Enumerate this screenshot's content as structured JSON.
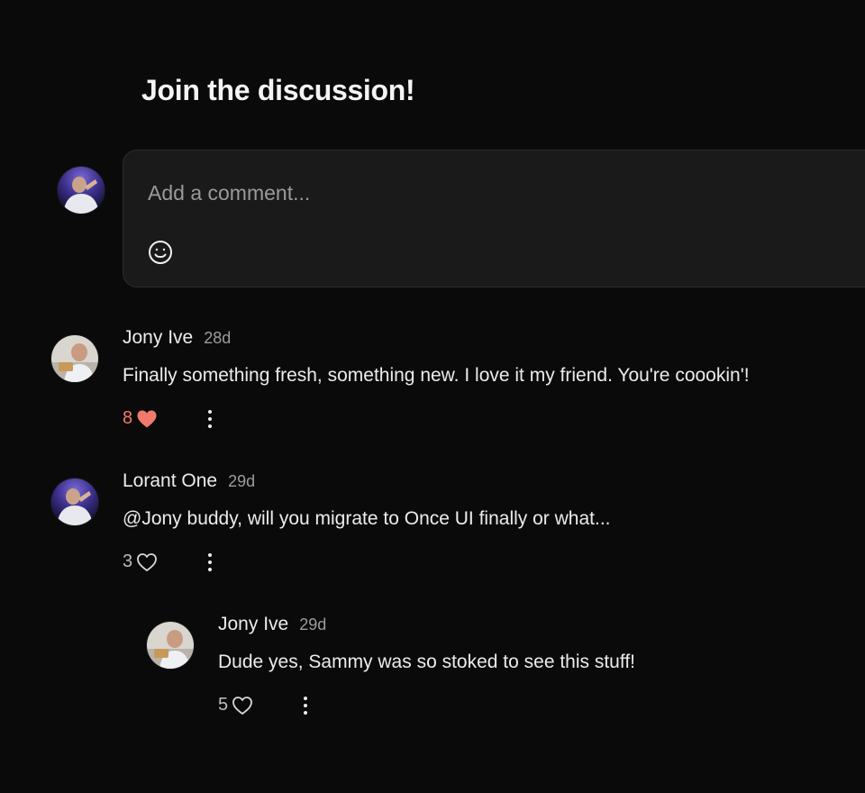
{
  "header": {
    "title": "Join the discussion!"
  },
  "composer": {
    "placeholder": "Add a comment...",
    "value": "",
    "emoji_icon": "smiley-icon"
  },
  "colors": {
    "background": "#0a0a0a",
    "composer_bg": "#1a1a1a",
    "liked_heart": "#f27a6c",
    "text": "#ececec",
    "muted": "#9c9c9c"
  },
  "comments": [
    {
      "author": "Jony Ive",
      "time": "28d",
      "text": "Finally something fresh, something new. I love it my friend. You're coookin'!",
      "likes": "8",
      "liked": true
    },
    {
      "author": "Lorant One",
      "time": "29d",
      "text": "@Jony buddy, will you migrate to Once UI finally or what...",
      "likes": "3",
      "liked": false
    }
  ],
  "replies": [
    {
      "author": "Jony Ive",
      "time": "29d",
      "text": "Dude yes, Sammy was so stoked to see this stuff!",
      "likes": "5",
      "liked": false
    }
  ]
}
